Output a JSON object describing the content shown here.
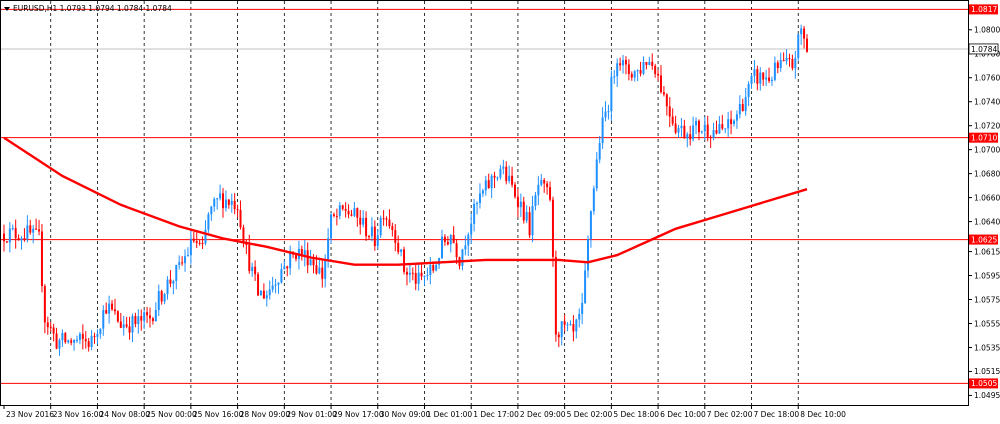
{
  "header": {
    "title": "EURUSD,H1  1.0793 1.0794 1.0784 1.0784"
  },
  "colors": {
    "bull": "#1e90ff",
    "bear": "#ff0000",
    "ma": "#ff0000",
    "level": "#ff0000",
    "current_line": "#c0c0c0",
    "grid": "#000000",
    "axis": "#000000"
  },
  "chart_data": {
    "type": "candlestick",
    "symbol": "EURUSD",
    "timeframe": "H1",
    "ylim": [
      1.0487,
      1.0824
    ],
    "grid": "vertical dashed",
    "y_ticks": [
      "1.0800",
      "1.0780",
      "1.0760",
      "1.0740",
      "1.0720",
      "1.0700",
      "1.0680",
      "1.0660",
      "1.0640",
      "1.0615",
      "1.0595",
      "1.0575",
      "1.0555",
      "1.0535",
      "1.0515",
      "1.0495"
    ],
    "x_ticks": [
      {
        "label": "23 Nov 2016",
        "bar": 0
      },
      {
        "label": "23 Nov 16:00",
        "bar": 16
      },
      {
        "label": "24 Nov 08:00",
        "bar": 32
      },
      {
        "label": "25 Nov 00:00",
        "bar": 48
      },
      {
        "label": "25 Nov 16:00",
        "bar": 64
      },
      {
        "label": "28 Nov 09:00",
        "bar": 80
      },
      {
        "label": "29 Nov 01:00",
        "bar": 96
      },
      {
        "label": "29 Nov 17:00",
        "bar": 112
      },
      {
        "label": "30 Nov 09:00",
        "bar": 128
      },
      {
        "label": "1 Dec 01:00",
        "bar": 144
      },
      {
        "label": "1 Dec 17:00",
        "bar": 160
      },
      {
        "label": "2 Dec 09:00",
        "bar": 176
      },
      {
        "label": "5 Dec 02:00",
        "bar": 192
      },
      {
        "label": "5 Dec 18:00",
        "bar": 208
      },
      {
        "label": "6 Dec 10:00",
        "bar": 224
      },
      {
        "label": "7 Dec 02:00",
        "bar": 240
      },
      {
        "label": "7 Dec 18:00",
        "bar": 256
      },
      {
        "label": "8 Dec 10:00",
        "bar": 272
      }
    ],
    "levels": [
      {
        "label": "1.0817",
        "value": 1.0817
      },
      {
        "label": "1.0710",
        "value": 1.071
      },
      {
        "label": "1.0625",
        "value": 1.0625
      },
      {
        "label": "1.0505",
        "value": 1.0505
      }
    ],
    "current_price": {
      "label": "1.0784",
      "value": 1.0784
    },
    "moving_average": [
      [
        0,
        1.071
      ],
      [
        20,
        1.0678
      ],
      [
        40,
        1.0654
      ],
      [
        60,
        1.0636
      ],
      [
        75,
        1.0626
      ],
      [
        90,
        1.0619
      ],
      [
        105,
        1.061
      ],
      [
        120,
        1.0604
      ],
      [
        135,
        1.0604
      ],
      [
        150,
        1.0606
      ],
      [
        165,
        1.0608
      ],
      [
        180,
        1.0608
      ],
      [
        190,
        1.0608
      ],
      [
        200,
        1.0606
      ],
      [
        210,
        1.0612
      ],
      [
        220,
        1.0623
      ],
      [
        230,
        1.0634
      ],
      [
        245,
        1.0645
      ],
      [
        260,
        1.0656
      ],
      [
        275,
        1.0667
      ]
    ],
    "price_path": [
      [
        0,
        1.063
      ],
      [
        8,
        1.063
      ],
      [
        12,
        1.0625
      ],
      [
        14,
        1.056
      ],
      [
        18,
        1.054
      ],
      [
        25,
        1.054
      ],
      [
        30,
        1.054
      ],
      [
        35,
        1.057
      ],
      [
        40,
        1.0555
      ],
      [
        45,
        1.0555
      ],
      [
        50,
        1.056
      ],
      [
        55,
        1.0585
      ],
      [
        60,
        1.06
      ],
      [
        65,
        1.0625
      ],
      [
        68,
        1.0615
      ],
      [
        70,
        1.0645
      ],
      [
        74,
        1.066
      ],
      [
        80,
        1.0655
      ],
      [
        83,
        1.0615
      ],
      [
        87,
        1.058
      ],
      [
        90,
        1.058
      ],
      [
        95,
        1.06
      ],
      [
        100,
        1.0615
      ],
      [
        105,
        1.061
      ],
      [
        109,
        1.0595
      ],
      [
        112,
        1.064
      ],
      [
        117,
        1.065
      ],
      [
        122,
        1.064
      ],
      [
        127,
        1.0625
      ],
      [
        130,
        1.065
      ],
      [
        134,
        1.063
      ],
      [
        137,
        1.06
      ],
      [
        142,
        1.059
      ],
      [
        147,
        1.06
      ],
      [
        150,
        1.062
      ],
      [
        153,
        1.063
      ],
      [
        156,
        1.061
      ],
      [
        159,
        1.0635
      ],
      [
        163,
        1.066
      ],
      [
        170,
        1.0685
      ],
      [
        176,
        1.066
      ],
      [
        180,
        1.0635
      ],
      [
        183,
        1.067
      ],
      [
        187,
        1.066
      ],
      [
        189,
        1.055
      ],
      [
        192,
        1.055
      ],
      [
        195,
        1.0545
      ],
      [
        198,
        1.0565
      ],
      [
        201,
        1.065
      ],
      [
        204,
        1.071
      ],
      [
        207,
        1.074
      ],
      [
        210,
        1.078
      ],
      [
        213,
        1.0765
      ],
      [
        217,
        1.0765
      ],
      [
        220,
        1.0775
      ],
      [
        223,
        1.077
      ],
      [
        226,
        1.0745
      ],
      [
        230,
        1.072
      ],
      [
        233,
        1.0715
      ],
      [
        237,
        1.0718
      ],
      [
        240,
        1.0718
      ],
      [
        245,
        1.0715
      ],
      [
        249,
        1.072
      ],
      [
        253,
        1.074
      ],
      [
        257,
        1.076
      ],
      [
        262,
        1.076
      ],
      [
        266,
        1.077
      ],
      [
        270,
        1.077
      ],
      [
        273,
        1.08
      ],
      [
        275,
        1.0784
      ]
    ]
  }
}
